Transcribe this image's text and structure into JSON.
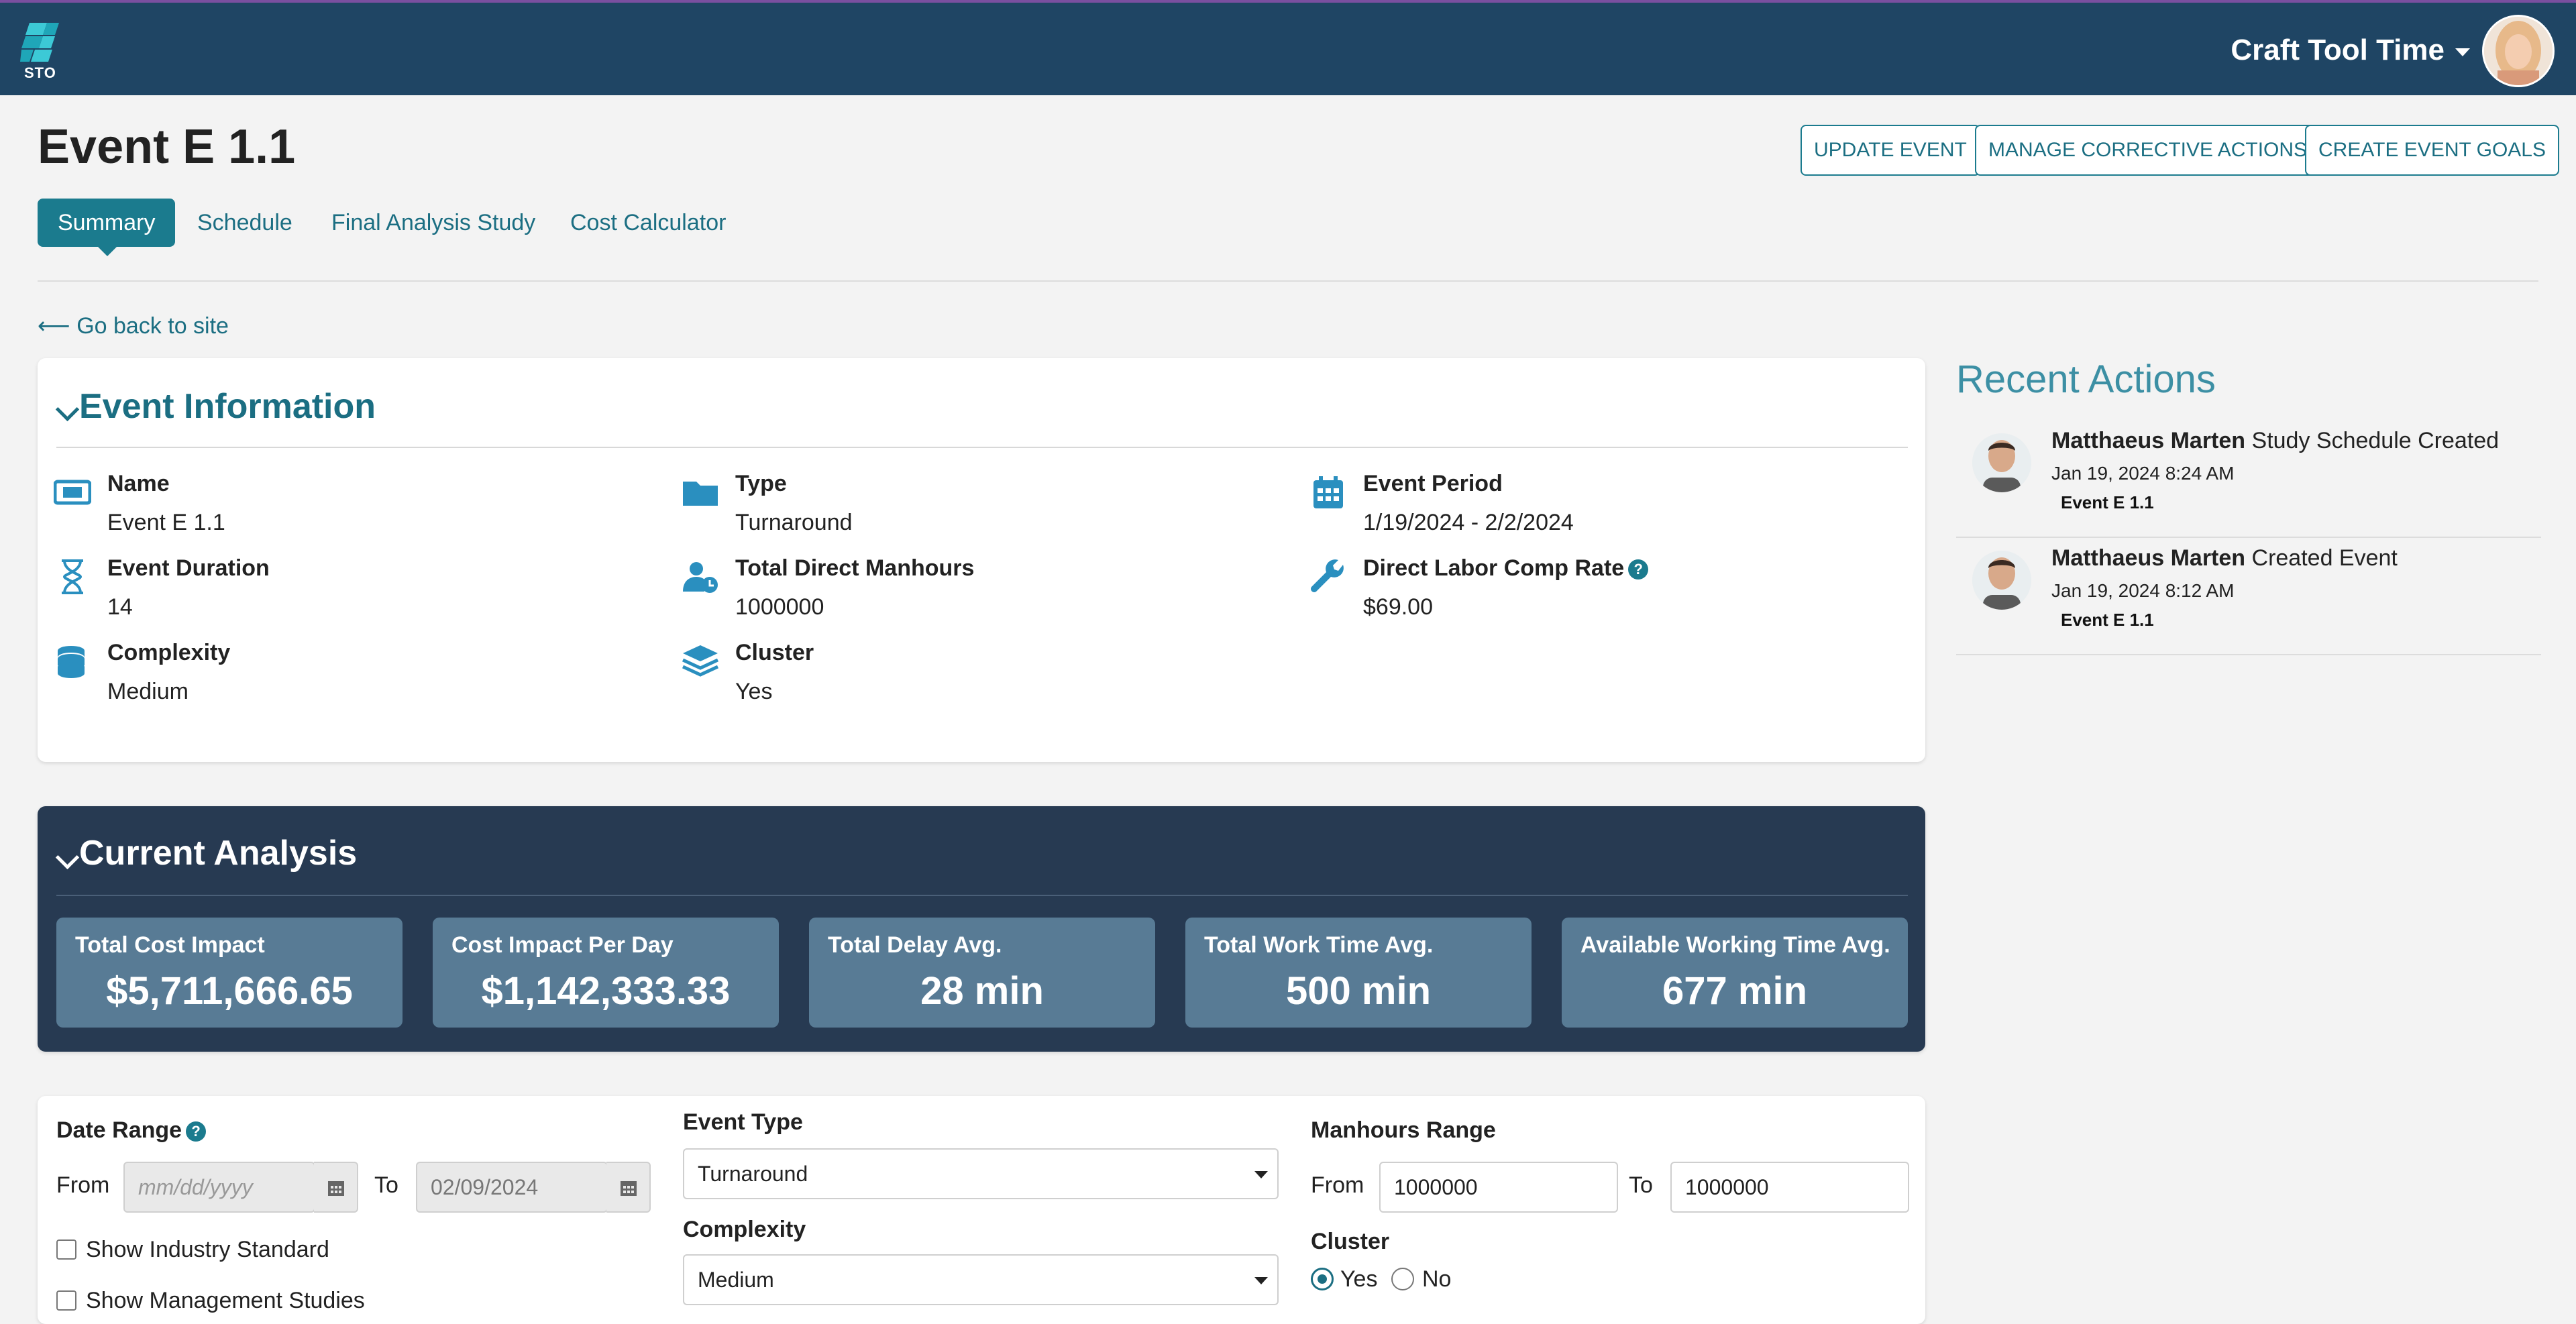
{
  "topbar": {
    "logo_text": "STO",
    "user_name": "Craft Tool Time",
    "brand_color": "#1f4564",
    "accent_color": "#1b7b8e"
  },
  "header": {
    "title": "Event E 1.1",
    "buttons": [
      "UPDATE EVENT",
      "MANAGE CORRECTIVE ACTIONS",
      "CREATE EVENT GOALS"
    ],
    "tabs": [
      "Summary",
      "Schedule",
      "Final Analysis Study",
      "Cost Calculator"
    ],
    "active_tab": "Summary",
    "back_link": "⟵ Go back to site"
  },
  "event_info": {
    "title": "Event Information",
    "items": [
      {
        "icon": "ticket-icon",
        "label": "Name",
        "value": "Event E 1.1"
      },
      {
        "icon": "folder-icon",
        "label": "Type",
        "value": "Turnaround"
      },
      {
        "icon": "calendar-icon",
        "label": "Event Period",
        "value": "1/19/2024 - 2/2/2024"
      },
      {
        "icon": "hourglass-icon",
        "label": "Event Duration",
        "value": "14"
      },
      {
        "icon": "user-clock-icon",
        "label": "Total Direct Manhours",
        "value": "1000000"
      },
      {
        "icon": "wrench-icon",
        "label": "Direct Labor Comp Rate",
        "value": "$69.00"
      },
      {
        "icon": "coins-icon",
        "label": "Complexity",
        "value": "Medium"
      },
      {
        "icon": "layers-icon",
        "label": "Cluster",
        "value": "Yes"
      }
    ]
  },
  "analysis": {
    "title": "Current Analysis",
    "metrics": [
      {
        "label": "Total Cost Impact",
        "value": "$5,711,666.65"
      },
      {
        "label": "Cost Impact Per Day",
        "value": "$1,142,333.33"
      },
      {
        "label": "Total Delay Avg.",
        "value": "28 min"
      },
      {
        "label": "Total Work Time Avg.",
        "value": "500 min"
      },
      {
        "label": "Available Working Time Avg.",
        "value": "677 min"
      }
    ]
  },
  "recent_actions": {
    "title": "Recent Actions",
    "items": [
      {
        "name": "Matthaeus Marten",
        "action": "Study Schedule Created",
        "date": "Jan 19, 2024 8:24 AM",
        "link": "Event E 1.1"
      },
      {
        "name": "Matthaeus Marten",
        "action": "Created Event",
        "date": "Jan 19, 2024 8:12 AM",
        "link": "Event E 1.1"
      }
    ]
  },
  "filters": {
    "date_range_label": "Date Range",
    "from_label": "From",
    "to_label": "To",
    "date_from_placeholder": "mm/dd/yyyy",
    "date_to_value": "02/09/2024",
    "show_industry_standard": "Show Industry Standard",
    "show_management_studies": "Show Management Studies",
    "event_type_label": "Event Type",
    "event_type_value": "Turnaround",
    "complexity_label": "Complexity",
    "complexity_value": "Medium",
    "manhours_label": "Manhours Range",
    "manhours_from": "1000000",
    "manhours_to": "1000000",
    "cluster_label": "Cluster",
    "cluster_yes": "Yes",
    "cluster_no": "No"
  }
}
